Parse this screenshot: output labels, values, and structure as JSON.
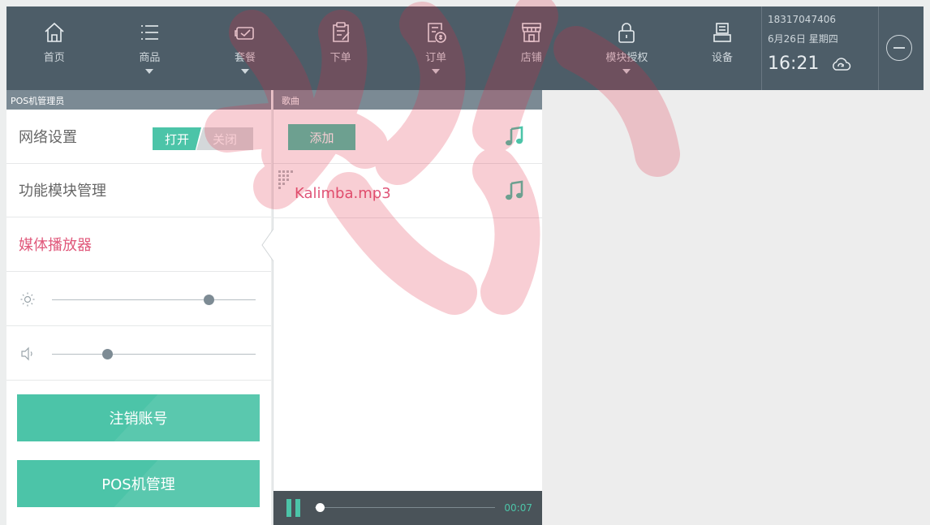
{
  "nav": {
    "items": [
      {
        "label": "首页",
        "icon": "home-icon",
        "has_caret": false
      },
      {
        "label": "商品",
        "icon": "list-icon",
        "has_caret": true
      },
      {
        "label": "套餐",
        "icon": "package-icon",
        "has_caret": true
      },
      {
        "label": "下单",
        "icon": "order-form-icon",
        "has_caret": false
      },
      {
        "label": "订单",
        "icon": "bill-icon",
        "has_caret": true
      },
      {
        "label": "店铺",
        "icon": "store-icon",
        "has_caret": false
      },
      {
        "label": "模块授权",
        "icon": "lock-icon",
        "has_caret": true
      },
      {
        "label": "设备",
        "icon": "printer-icon",
        "has_caret": false
      }
    ]
  },
  "status": {
    "phone": "18317047406",
    "date": "6月26日 星期四",
    "time": "16:21"
  },
  "left_panel": {
    "header": "POS机管理员",
    "network_label": "网络设置",
    "toggle_on": "打开",
    "toggle_off": "关闭",
    "module_label": "功能模块管理",
    "media_label": "媒体播放器",
    "brightness_level": 0.77,
    "volume_level": 0.27,
    "logout_label": "注销账号",
    "pos_manage_label": "POS机管理"
  },
  "song_panel": {
    "header": "歌曲",
    "add_label": "添加",
    "songs": [
      {
        "name": "Kalimba.mp3"
      }
    ],
    "player": {
      "time": "00:07",
      "progress": 0.03
    }
  },
  "colors": {
    "accent": "#4cc4a8",
    "active_text": "#e0577a",
    "nav_bg": "#4d5d68",
    "header_bg": "#7b8a94"
  }
}
